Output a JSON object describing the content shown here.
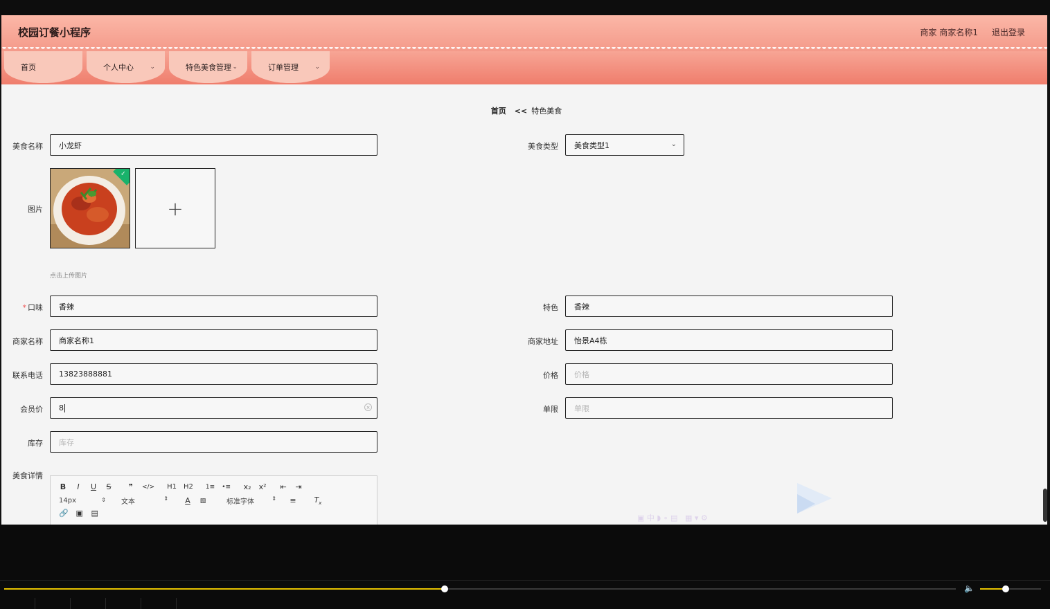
{
  "header": {
    "brand": "校园订餐小程序",
    "user": "商家 商家名称1",
    "logout": "退出登录"
  },
  "nav": {
    "items": [
      {
        "label": "首页",
        "has_dropdown": false
      },
      {
        "label": "个人中心",
        "has_dropdown": true
      },
      {
        "label": "特色美食管理",
        "has_dropdown": true
      },
      {
        "label": "订单管理",
        "has_dropdown": true
      }
    ]
  },
  "breadcrumb": {
    "home": "首页",
    "sep": "<<",
    "current": "特色美食"
  },
  "form": {
    "food_name": {
      "label": "美食名称",
      "value": "小龙虾"
    },
    "food_type": {
      "label": "美食类型",
      "value": "美食类型1"
    },
    "image": {
      "label": "图片",
      "hint": "点击上传图片"
    },
    "taste": {
      "label": "口味",
      "required_mark": "*",
      "value": "香辣"
    },
    "feature": {
      "label": "特色",
      "value": "香辣"
    },
    "merchant_name": {
      "label": "商家名称",
      "value": "商家名称1"
    },
    "merchant_address": {
      "label": "商家地址",
      "value": "怡景A4栋"
    },
    "phone": {
      "label": "联系电话",
      "value": "13823888881"
    },
    "price": {
      "label": "价格",
      "placeholder": "价格"
    },
    "member_price": {
      "label": "会员价",
      "value": "8"
    },
    "limit": {
      "label": "单限",
      "placeholder": "单限"
    },
    "stock": {
      "label": "库存",
      "placeholder": "库存"
    },
    "details": {
      "label": "美食详情"
    }
  },
  "editor": {
    "row1": [
      "B",
      "I",
      "U",
      "S",
      "❞",
      "</>",
      "H1",
      "H2",
      "1≡",
      "•≡",
      "x₂",
      "x²",
      "⇤",
      "⇥"
    ],
    "font_size": "14px",
    "text_style": "文本",
    "font_family": "标准字体"
  },
  "player": {
    "progress": 0.463,
    "volume": 0.42
  }
}
